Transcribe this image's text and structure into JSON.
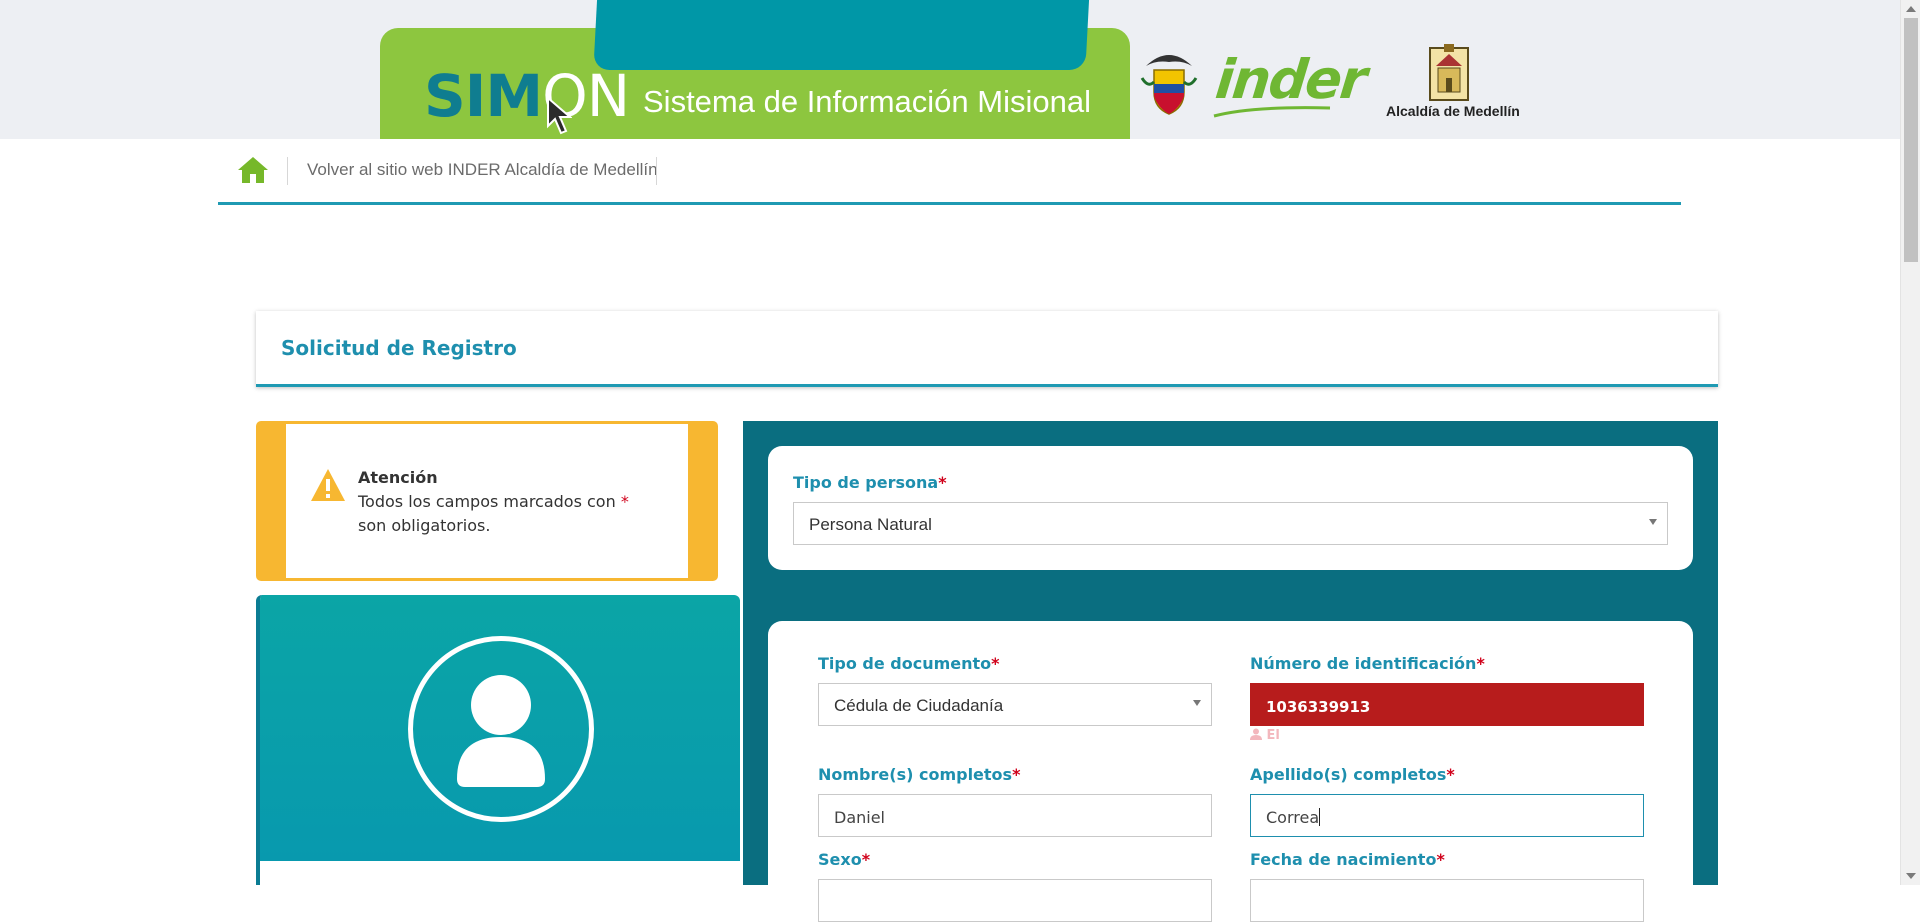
{
  "header": {
    "logo_part1": "SIM",
    "logo_part2": "ON",
    "subtitle": "Sistema de Información Misional",
    "partner_logo": "inder",
    "city_logo_text": "Alcaldía de Medellín"
  },
  "nav": {
    "home_icon": "home-icon",
    "back_link": "Volver al sitio web INDER Alcaldía de Medellín"
  },
  "page": {
    "title": "Solicitud de Registro"
  },
  "alert": {
    "icon": "warning-icon",
    "title": "Atención",
    "text_before": "Todos los campos marcados con ",
    "required_mark": "*",
    "text_after": " son obligatorios."
  },
  "form": {
    "required_mark": "*",
    "tipo_persona": {
      "label": "Tipo de persona",
      "value": "Persona Natural"
    },
    "tipo_documento": {
      "label": "Tipo de documento",
      "value": "Cédula de Ciudadanía"
    },
    "numero_id": {
      "label": "Número de identificación",
      "value": "1036339913",
      "hint": "El"
    },
    "nombres": {
      "label": "Nombre(s) completos",
      "value": "Daniel"
    },
    "apellidos": {
      "label": "Apellido(s) completos",
      "value": "Correa"
    },
    "sexo": {
      "label": "Sexo"
    },
    "fecha_nacimiento": {
      "label": "Fecha de nacimiento"
    }
  },
  "colors": {
    "brand_green": "#8dc63f",
    "brand_teal": "#0097a7",
    "accent_blue": "#1e8fae",
    "panel_teal": "#0a6e80",
    "alert_yellow": "#f7b731",
    "error_red": "#b71c1c"
  }
}
